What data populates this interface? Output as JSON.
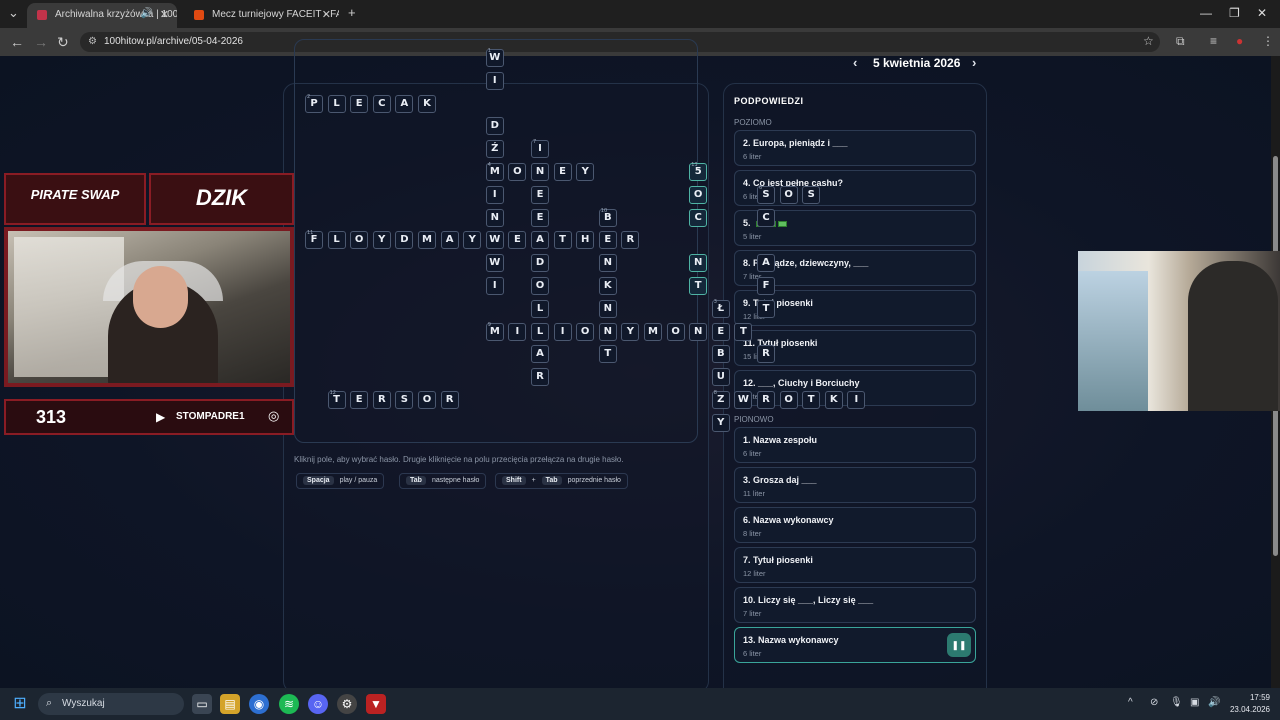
{
  "browser": {
    "tabs": [
      {
        "label": "Archiwalna krzyżówka | 100",
        "active": true
      },
      {
        "label": "Mecz turniejowy FACEIT - FACE",
        "active": false
      }
    ],
    "url": "100hitow.pl/archive/05-04-2026"
  },
  "date_nav": {
    "date": "5 kwietnia 2026",
    "prev": "‹",
    "next": "›"
  },
  "crossword": {
    "cells": [
      {
        "c": 8,
        "r": 0,
        "l": "W",
        "n": "1"
      },
      {
        "c": 8,
        "r": 1,
        "l": "I"
      },
      {
        "c": 0,
        "r": 2,
        "l": "P",
        "n": "2"
      },
      {
        "c": 1,
        "r": 2,
        "l": "L"
      },
      {
        "c": 2,
        "r": 2,
        "l": "E"
      },
      {
        "c": 3,
        "r": 2,
        "l": "C"
      },
      {
        "c": 4,
        "r": 2,
        "l": "A"
      },
      {
        "c": 5,
        "r": 2,
        "l": "K"
      },
      {
        "c": 8,
        "r": 3,
        "l": "D"
      },
      {
        "c": 8,
        "r": 4,
        "l": "Ź"
      },
      {
        "c": 10,
        "r": 4,
        "l": "I",
        "n": "7"
      },
      {
        "c": 8,
        "r": 5,
        "l": "M",
        "n": "4"
      },
      {
        "c": 9,
        "r": 5,
        "l": "O"
      },
      {
        "c": 10,
        "r": 5,
        "l": "N"
      },
      {
        "c": 11,
        "r": 5,
        "l": "E"
      },
      {
        "c": 12,
        "r": 5,
        "l": "Y"
      },
      {
        "c": 17,
        "r": 5,
        "l": "5",
        "n": "13",
        "hl": true
      },
      {
        "c": 8,
        "r": 6,
        "l": "I"
      },
      {
        "c": 10,
        "r": 6,
        "l": "E"
      },
      {
        "c": 17,
        "r": 6,
        "l": "O",
        "hl": true
      },
      {
        "c": 20,
        "r": 6,
        "l": "S",
        "n": "6"
      },
      {
        "c": 21,
        "r": 6,
        "l": "O"
      },
      {
        "c": 22,
        "r": 6,
        "l": "S"
      },
      {
        "c": 8,
        "r": 7,
        "l": "N"
      },
      {
        "c": 10,
        "r": 7,
        "l": "E"
      },
      {
        "c": 13,
        "r": 7,
        "l": "B",
        "n": "10"
      },
      {
        "c": 17,
        "r": 7,
        "l": "C",
        "hl": true
      },
      {
        "c": 20,
        "r": 7,
        "l": "C"
      },
      {
        "c": 0,
        "r": 8,
        "l": "F",
        "n": "11"
      },
      {
        "c": 1,
        "r": 8,
        "l": "L"
      },
      {
        "c": 2,
        "r": 8,
        "l": "O"
      },
      {
        "c": 3,
        "r": 8,
        "l": "Y"
      },
      {
        "c": 4,
        "r": 8,
        "l": "D"
      },
      {
        "c": 5,
        "r": 8,
        "l": "M"
      },
      {
        "c": 6,
        "r": 8,
        "l": "A"
      },
      {
        "c": 7,
        "r": 8,
        "l": "Y"
      },
      {
        "c": 8,
        "r": 8,
        "l": "W"
      },
      {
        "c": 9,
        "r": 8,
        "l": "E"
      },
      {
        "c": 10,
        "r": 8,
        "l": "A"
      },
      {
        "c": 11,
        "r": 8,
        "l": "T"
      },
      {
        "c": 12,
        "r": 8,
        "l": "H"
      },
      {
        "c": 13,
        "r": 8,
        "l": "E"
      },
      {
        "c": 14,
        "r": 8,
        "l": "R"
      },
      {
        "c": 8,
        "r": 9,
        "l": "W"
      },
      {
        "c": 10,
        "r": 9,
        "l": "D"
      },
      {
        "c": 13,
        "r": 9,
        "l": "N"
      },
      {
        "c": 17,
        "r": 9,
        "l": "N",
        "hl": true
      },
      {
        "c": 20,
        "r": 9,
        "l": "A"
      },
      {
        "c": 8,
        "r": 10,
        "l": "I"
      },
      {
        "c": 10,
        "r": 10,
        "l": "O"
      },
      {
        "c": 13,
        "r": 10,
        "l": "K"
      },
      {
        "c": 17,
        "r": 10,
        "l": "T",
        "hl": true
      },
      {
        "c": 20,
        "r": 10,
        "l": "F"
      },
      {
        "c": 10,
        "r": 11,
        "l": "L"
      },
      {
        "c": 13,
        "r": 11,
        "l": "N"
      },
      {
        "c": 18,
        "r": 11,
        "l": "Ł",
        "n": "3"
      },
      {
        "c": 20,
        "r": 11,
        "l": "T"
      },
      {
        "c": 8,
        "r": 12,
        "l": "M",
        "n": "9"
      },
      {
        "c": 9,
        "r": 12,
        "l": "I"
      },
      {
        "c": 10,
        "r": 12,
        "l": "L"
      },
      {
        "c": 11,
        "r": 12,
        "l": "I"
      },
      {
        "c": 12,
        "r": 12,
        "l": "O"
      },
      {
        "c": 13,
        "r": 12,
        "l": "N"
      },
      {
        "c": 14,
        "r": 12,
        "l": "Y"
      },
      {
        "c": 15,
        "r": 12,
        "l": "M"
      },
      {
        "c": 16,
        "r": 12,
        "l": "O"
      },
      {
        "c": 17,
        "r": 12,
        "l": "N"
      },
      {
        "c": 18,
        "r": 12,
        "l": "E"
      },
      {
        "c": 19,
        "r": 12,
        "l": "T"
      },
      {
        "c": 10,
        "r": 13,
        "l": "A"
      },
      {
        "c": 13,
        "r": 13,
        "l": "T"
      },
      {
        "c": 18,
        "r": 13,
        "l": "B"
      },
      {
        "c": 20,
        "r": 13,
        "l": "R"
      },
      {
        "c": 10,
        "r": 14,
        "l": "R"
      },
      {
        "c": 18,
        "r": 14,
        "l": "U"
      },
      {
        "c": 1,
        "r": 15,
        "l": "T",
        "n": "12"
      },
      {
        "c": 2,
        "r": 15,
        "l": "E"
      },
      {
        "c": 3,
        "r": 15,
        "l": "R"
      },
      {
        "c": 4,
        "r": 15,
        "l": "S"
      },
      {
        "c": 5,
        "r": 15,
        "l": "O"
      },
      {
        "c": 6,
        "r": 15,
        "l": "R"
      },
      {
        "c": 18,
        "r": 15,
        "l": "Z",
        "n": "8"
      },
      {
        "c": 19,
        "r": 15,
        "l": "W"
      },
      {
        "c": 20,
        "r": 15,
        "l": "R"
      },
      {
        "c": 21,
        "r": 15,
        "l": "O"
      },
      {
        "c": 22,
        "r": 15,
        "l": "T"
      },
      {
        "c": 23,
        "r": 15,
        "l": "K"
      },
      {
        "c": 24,
        "r": 15,
        "l": "I"
      },
      {
        "c": 18,
        "r": 16,
        "l": "Y"
      }
    ],
    "hint": "Kliknij pole, aby wybrać hasło. Drugie kliknięcie na polu przecięcia przełącza na drugie hasło.",
    "shortcuts": [
      {
        "keys": [
          "Spacja"
        ],
        "desc": "play / pauza"
      },
      {
        "keys": [
          "Tab"
        ],
        "desc": "następne hasło"
      },
      {
        "keys": [
          "Shift",
          "Tab"
        ],
        "desc": "poprzednie hasło"
      }
    ]
  },
  "clues": {
    "title": "PODPOWIEDZI",
    "across_label": "POZIOMO",
    "down_label": "PIONOWO",
    "across": [
      {
        "title": "2. Europa, pieniądz i ___",
        "sub": "6 liter"
      },
      {
        "title": "4. Co jest pełne cashu?",
        "sub": "6 liter"
      },
      {
        "title": "5.",
        "sub": "5 liter",
        "icons": 3
      },
      {
        "title": "8. Pieniądze, dziewczyny, ___",
        "sub": "7 liter"
      },
      {
        "title": "9. Tytuł piosenki",
        "sub": "12 liter"
      },
      {
        "title": "11. Tytuł piosenki",
        "sub": "15 liter"
      },
      {
        "title": "12. ___, Ciuchy i Borciuchy",
        "sub": "3 liter"
      }
    ],
    "down": [
      {
        "title": "1. Nazwa zespołu",
        "sub": "6 liter"
      },
      {
        "title": "3. Grosza daj ___",
        "sub": "11 liter"
      },
      {
        "title": "6. Nazwa wykonawcy",
        "sub": "8 liter"
      },
      {
        "title": "7. Tytuł piosenki",
        "sub": "12 liter"
      },
      {
        "title": "10. Liczy się ___, Liczy się ___",
        "sub": "7 liter"
      },
      {
        "title": "13. Nazwa wykonawcy",
        "sub": "6 liter",
        "active": true
      }
    ]
  },
  "overlay": {
    "sponsor1": "PIRATE SWAP",
    "sponsor2": "DZIK",
    "counter": "313",
    "youtube": "STOMPADRE1"
  },
  "taskbar": {
    "search": "Wyszukaj",
    "time": "17:59",
    "date": "23.04.2026"
  },
  "icons": {
    "prev": "chevron-left-icon",
    "next": "chevron-right-icon",
    "play": "pause-icon"
  }
}
